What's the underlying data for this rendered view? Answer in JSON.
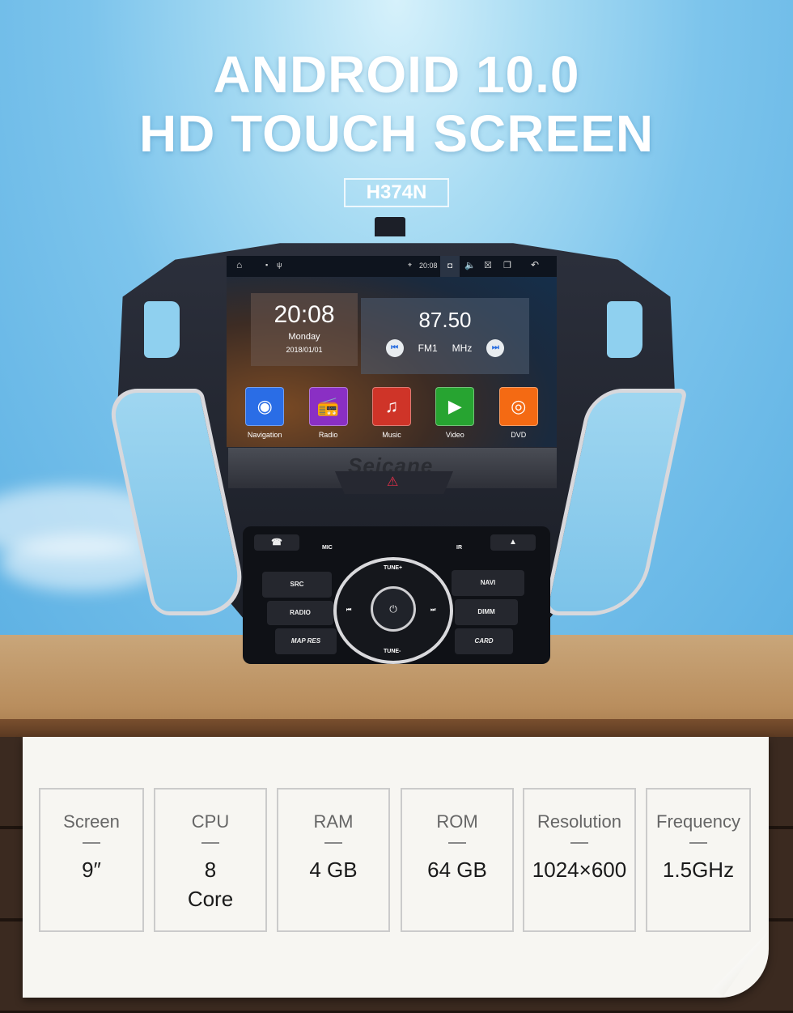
{
  "headline": {
    "line1": "ANDROID 10.0",
    "line2": "HD TOUCH SCREEN"
  },
  "model": "H374N",
  "statusbar": {
    "time": "20:08",
    "icons": [
      "home-icon",
      "image-icon",
      "usb-icon",
      "location-icon",
      "screenshot-icon",
      "volume-icon",
      "close-window-icon",
      "recent-apps-icon",
      "back-icon"
    ]
  },
  "clock_widget": {
    "time": "20:08",
    "day": "Monday",
    "date": "2018/01/01"
  },
  "radio_widget": {
    "frequency": "87.50",
    "band": "FM1",
    "unit": "MHz"
  },
  "apps": [
    {
      "label": "Navigation",
      "color": "#2a6de6",
      "icon": "navigation-icon",
      "glyph": "◉"
    },
    {
      "label": "Radio",
      "color": "#8a2fc4",
      "icon": "radio-icon",
      "glyph": "📻"
    },
    {
      "label": "Music",
      "color": "#cf3428",
      "icon": "music-icon",
      "glyph": "♫"
    },
    {
      "label": "Video",
      "color": "#27a431",
      "icon": "video-icon",
      "glyph": "▶"
    },
    {
      "label": "DVD",
      "color": "#f46a13",
      "icon": "dvd-icon",
      "glyph": "◎"
    }
  ],
  "brand": "Seicane",
  "panel": {
    "mic": "MIC",
    "ir": "IR",
    "left_keys": [
      "SRC",
      "RADIO",
      "MAP RES"
    ],
    "right_keys": [
      "NAVI",
      "DIMM",
      "CARD"
    ],
    "tune_up": "TUNE+",
    "tune_down": "TUNE-",
    "call": "☎",
    "eject": "▲",
    "power": "⏻",
    "prev": "⏮",
    "next": "⏭"
  },
  "specs": [
    {
      "label": "Screen",
      "value": "9″"
    },
    {
      "label": "CPU",
      "value": "8",
      "value2": "Core"
    },
    {
      "label": "RAM",
      "value": "4 GB"
    },
    {
      "label": "ROM",
      "value": "64 GB"
    },
    {
      "label": "Resolution",
      "value": "1024×600"
    },
    {
      "label": "Frequency",
      "value": "1.5GHz"
    }
  ]
}
